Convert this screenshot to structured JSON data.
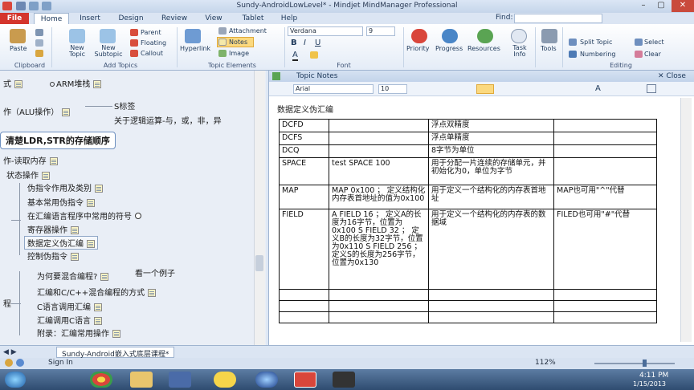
{
  "window": {
    "title": "Sundy-AndroidLowLevel* - Mindjet MindManager Professional",
    "min": "–",
    "max": "▢",
    "close": "✕"
  },
  "tabs": [
    "File",
    "Home",
    "Insert",
    "Design",
    "Review",
    "View",
    "Tablet",
    "Help"
  ],
  "find_label": "Find:",
  "ribbon": {
    "paste": "Paste",
    "new_topic": "New Topic",
    "new_subtopic": "New Subtopic",
    "parent": "Parent",
    "floating": "Floating",
    "callout": "Callout",
    "hyperlink": "Hyperlink",
    "attachment": "Attachment",
    "notes": "Notes",
    "image": "Image",
    "font_name": "Verdana",
    "font_size": "9",
    "priority": "Priority",
    "progress": "Progress",
    "resources": "Resources",
    "task_info": "Task Info",
    "tools": "Tools",
    "split_topic": "Split Topic",
    "select": "Select",
    "numbering": "Numbering",
    "clear": "Clear",
    "groups": {
      "clipboard": "Clipboard",
      "add_topics": "Add Topics",
      "topic_elements": "Topic Elements",
      "font": "Font",
      "editing": "Editing"
    }
  },
  "map": {
    "nodes": {
      "n1": "式",
      "n2": "ARM堆栈",
      "n3": "作（ALU操作）",
      "n4": "S标签",
      "n5": "关于逻辑运算-与，或，非，异",
      "n6": "清楚LDR,STR的存储顺序",
      "n7": "作-读取内存",
      "n8": "状态操作",
      "n9": "伪指令作用及类别",
      "n10": "基本常用伪指令",
      "n11": "在汇编语言程序中常用的符号",
      "n12": "寄存器操作",
      "n13": "数据定义伪汇编",
      "n14": "控制伪指令",
      "n15": "为何要混合编程?",
      "n16": "看一个例子",
      "n17": "汇编和C/C++混合编程的方式",
      "n18": "程",
      "n19": "C语言调用汇编",
      "n20": "汇编调用C语言",
      "n21": "附录：汇编常用操作"
    }
  },
  "notes": {
    "header": "Topic Notes",
    "close": "Close",
    "font_name": "Arial",
    "font_size": "10",
    "doc_title": "数据定义伪汇编",
    "rows": [
      {
        "c1": "DCFD",
        "c2": "",
        "c3": "浮点双精度",
        "c4": ""
      },
      {
        "c1": "DCFS",
        "c2": "",
        "c3": "浮点单精度",
        "c4": ""
      },
      {
        "c1": "DCQ",
        "c2": "",
        "c3": "8字节为单位",
        "c4": ""
      },
      {
        "c1": "SPACE",
        "c2": "test SPACE 100",
        "c3": "用于分配一片连续的存储单元，并初始化为0，单位为字节",
        "c4": ""
      },
      {
        "c1": "MAP",
        "c2": "MAP 0x100 ； 定义结构化内存表首地址的值为0x100",
        "c3": "用于定义一个结构化的内存表首地址",
        "c4": "MAP也可用\"^\"代替"
      },
      {
        "c1": "FIELD",
        "c2": "A FIELD 16 ； 定义A的长度为16字节，位置为0x100 S FIELD 32 ； 定义B的长度为32字节，位置为0x110 S FIELD 256 ； 定义S的长度为256字节，位置为0x130",
        "c3": "用于定义一个结构化的内存表的数据域",
        "c4": "FILED也可用\"#\"代替"
      },
      {
        "c1": "",
        "c2": "",
        "c3": "",
        "c4": ""
      },
      {
        "c1": "",
        "c2": "",
        "c3": "",
        "c4": ""
      },
      {
        "c1": "",
        "c2": "",
        "c3": "",
        "c4": ""
      }
    ]
  },
  "docbar": {
    "tab": "Sundy-Android嵌入式底层课程*"
  },
  "status": {
    "signin": "Sign In",
    "zoom": "112%"
  },
  "taskbar": {
    "time": "4:11 PM",
    "date": "1/15/2013"
  }
}
